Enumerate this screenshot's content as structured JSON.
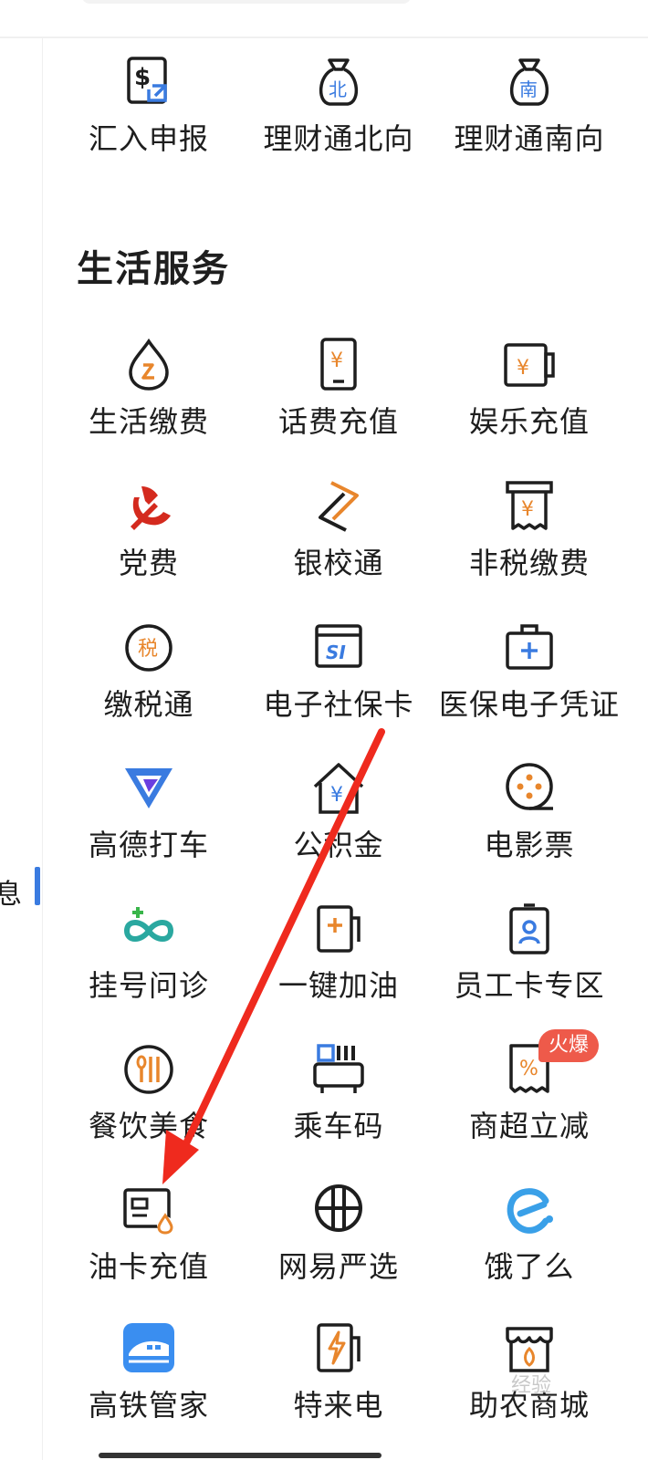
{
  "sidebar": {
    "partial_label": "息"
  },
  "top_group": {
    "items": [
      {
        "label": "汇入申报",
        "icon": "dollar-receipt-icon"
      },
      {
        "label": "理财通北向",
        "icon": "money-bag-north-icon",
        "glyph": "北"
      },
      {
        "label": "理财通南向",
        "icon": "money-bag-south-icon",
        "glyph": "南"
      }
    ]
  },
  "section": {
    "title": "生活服务"
  },
  "services": [
    {
      "label": "生活缴费",
      "icon": "utility-drop-icon"
    },
    {
      "label": "话费充值",
      "icon": "phone-yuan-icon"
    },
    {
      "label": "娱乐充值",
      "icon": "ticket-yuan-icon"
    },
    {
      "label": "党费",
      "icon": "party-emblem-icon"
    },
    {
      "label": "银校通",
      "icon": "campus-pay-icon"
    },
    {
      "label": "非税缴费",
      "icon": "receipt-yuan-icon"
    },
    {
      "label": "缴税通",
      "icon": "tax-circle-icon",
      "glyph": "税"
    },
    {
      "label": "电子社保卡",
      "icon": "social-security-card-icon",
      "glyph": "SI"
    },
    {
      "label": "医保电子凭证",
      "icon": "medical-kit-icon"
    },
    {
      "label": "高德打车",
      "icon": "amap-taxi-icon"
    },
    {
      "label": "公积金",
      "icon": "housing-fund-icon"
    },
    {
      "label": "电影票",
      "icon": "film-reel-icon"
    },
    {
      "label": "挂号问诊",
      "icon": "infinity-plus-icon"
    },
    {
      "label": "一键加油",
      "icon": "fuel-pump-icon"
    },
    {
      "label": "员工卡专区",
      "icon": "employee-badge-icon"
    },
    {
      "label": "餐饮美食",
      "icon": "dining-utensils-icon"
    },
    {
      "label": "乘车码",
      "icon": "bus-qr-icon"
    },
    {
      "label": "商超立减",
      "icon": "discount-receipt-icon"
    },
    {
      "label": "油卡充值",
      "icon": "fuel-card-icon"
    },
    {
      "label": "网易严选",
      "icon": "netease-yanxuan-icon"
    },
    {
      "label": "饿了么",
      "icon": "eleme-icon"
    },
    {
      "label": "高铁管家",
      "icon": "high-speed-train-icon"
    },
    {
      "label": "特来电",
      "icon": "ev-charger-icon"
    },
    {
      "label": "助农商城",
      "icon": "farm-store-icon"
    }
  ],
  "badge": {
    "text": "火爆"
  },
  "watermark": "经验",
  "colors": {
    "accent_orange": "#e8862c",
    "accent_blue": "#3a7be0",
    "party_red": "#d42a1e",
    "badge_red": "#ee5a4a",
    "arrow_red": "#ef2a1e"
  }
}
